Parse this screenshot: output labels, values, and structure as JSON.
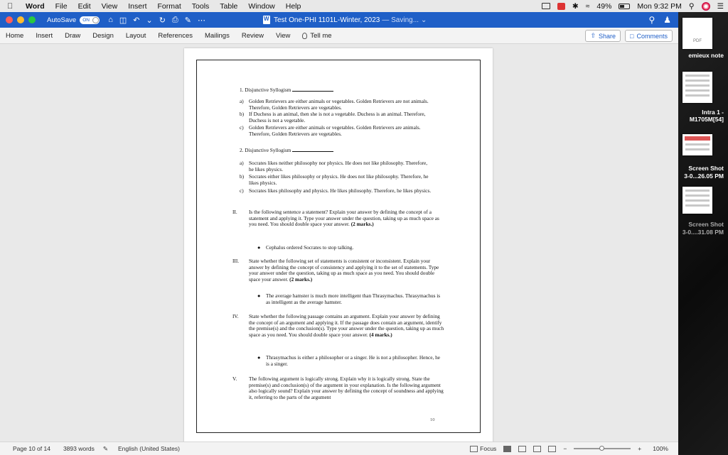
{
  "menubar": {
    "app": "Word",
    "items": [
      "File",
      "Edit",
      "View",
      "Insert",
      "Format",
      "Tools",
      "Table",
      "Window",
      "Help"
    ],
    "battery": "49%",
    "clock": "Mon 9:32 PM"
  },
  "titlebar": {
    "autosave_label": "AutoSave",
    "autosave_state": "ON",
    "document_title": "Test One-PHI 1101L-Winter, 2023",
    "saving": "— Saving...",
    "colors": {
      "bar": "#1f5fc7",
      "close": "#ff5f57",
      "minimize": "#febc2e",
      "zoom": "#28c840"
    }
  },
  "ribbon": {
    "tabs": [
      "Home",
      "Insert",
      "Draw",
      "Design",
      "Layout",
      "References",
      "Mailings",
      "Review",
      "View"
    ],
    "tell_me": "Tell me",
    "share": "Share",
    "comments": "Comments"
  },
  "document": {
    "q1_title": "1.   Disjunctive Syllogism",
    "q1": [
      {
        "label": "a)",
        "text": "Golden Retrievers are either animals or vegetables. Golden Retrievers are not animals.  Therefore, Golden Retrievers are vegetables."
      },
      {
        "label": "b)",
        "text": "If Duchess is an animal, then she is not a vegetable.  Duchess is an animal.  Therefore, Duchess is not a vegetable."
      },
      {
        "label": "c)",
        "text": "Golden Retrievers are either animals or vegetables.  Golden Retrievers are animals. Therefore, Golden Retrievers are vegetables."
      }
    ],
    "q2_title": "2.   Disjunctive Syllogism",
    "q2": [
      {
        "label": "a)",
        "text": "Socrates likes neither philosophy nor physics.  He does not like philosophy.  Therefore, he likes physics."
      },
      {
        "label": "b)",
        "text": "Socrates either likes philosophy or physics.  He does not like philosophy.  Therefore, he likes physics."
      },
      {
        "label": "c)",
        "text": "Socrates likes philosophy and physics.  He likes philosophy. Therefore, he likes physics."
      }
    ],
    "sections": [
      {
        "num": "II.",
        "text": "Is the following sentence a statement?  Explain your answer by defining the concept of a statement and applying it. Type your answer under the question, taking up as much space as you need. You should double space your answer.",
        "marks": "(2 marks.)",
        "bullet": "Cephalus ordered Socrates to stop talking."
      },
      {
        "num": "III.",
        "text": "State whether the following set of statements is consistent or inconsistent. Explain your answer by defining the concept of consistency and applying it to the set of statements. Type your answer under the question, taking up as much space as you need. You should double space your answer.",
        "marks": "(2 marks.)",
        "bullet": "The average hamster is much more intelligent than Thrasymachus. Thrasymachus is as intelligent as the average hamster."
      },
      {
        "num": "IV.",
        "text": "State whether the following passage contains an argument. Explain your answer by defining the concept of an argument and applying it. If the passage does contain an argument, identify the premise(s) and the conclusion(s). Type your answer under the question, taking up as much space as you need. You should double space your answer.",
        "marks": "(4 marks.)",
        "bullet": "Thrasymachus is either a philosopher or a singer.  He is not a philosopher. Hence, he is a singer."
      },
      {
        "num": "V.",
        "text": "The following argument is logically strong. Explain why it is logically strong. State the premise(s) and conclusion(s) of the argument in your explanation. Is the following argument also logically sound? Explain your answer by defining the concept of soundness and applying it, referring to the parts of the argument",
        "marks": "",
        "bullet": ""
      }
    ],
    "page_number": "10"
  },
  "status": {
    "page": "Page 10 of 14",
    "words": "3893 words",
    "language": "English (United States)",
    "focus": "Focus",
    "zoom": "100%"
  },
  "desktop": {
    "items": [
      {
        "label": "PDF",
        "caption": "emieux note"
      },
      {
        "label": "",
        "caption": "Intra 1 -"
      },
      {
        "label": "",
        "caption": "M1705M[54]"
      },
      {
        "label": "",
        "caption": "Screen Shot"
      },
      {
        "label": "",
        "caption": "3-0...26.05 PM"
      },
      {
        "label": "",
        "caption": "Screen Shot"
      },
      {
        "label": "",
        "caption": "3-0....31.08 PM"
      }
    ]
  }
}
